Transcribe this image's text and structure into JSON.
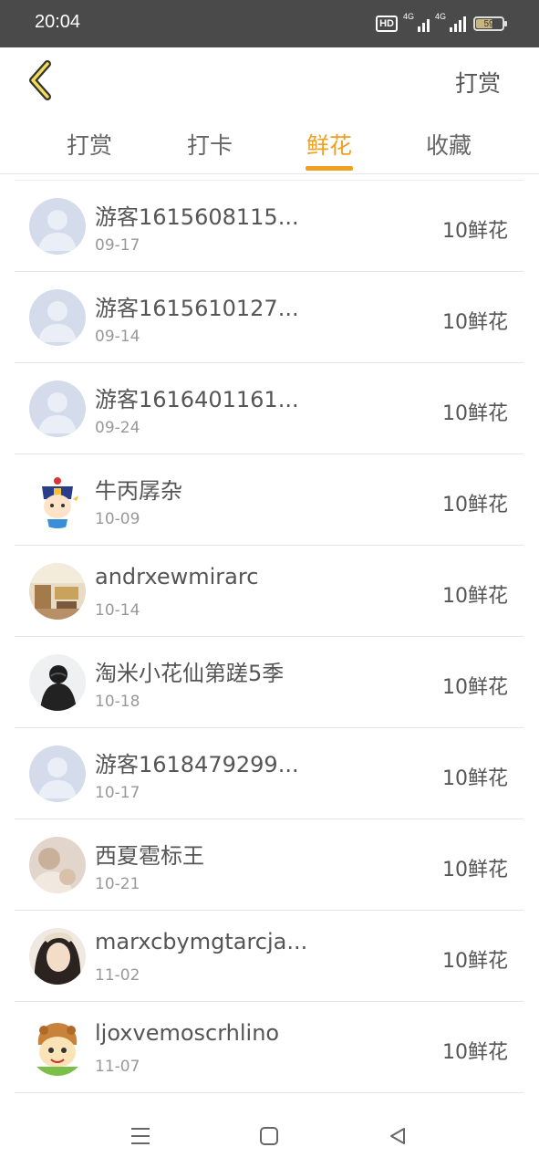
{
  "status_bar": {
    "time": "20:04",
    "hd_label": "HD",
    "network_1": "4G",
    "network_2": "4G",
    "battery": "59"
  },
  "header": {
    "action_label": "打赏",
    "back_icon": "chevron-left-icon",
    "accent_color": "#f0a020"
  },
  "tabs": [
    {
      "label": "打赏",
      "active": false
    },
    {
      "label": "打卡",
      "active": false
    },
    {
      "label": "鲜花",
      "active": true
    },
    {
      "label": "收藏",
      "active": false
    }
  ],
  "records": [
    {
      "name": "游客1615608115...",
      "date": "09-17",
      "amount": "10鲜花",
      "avatar": "default-avatar"
    },
    {
      "name": "游客1615610127...",
      "date": "09-14",
      "amount": "10鲜花",
      "avatar": "default-avatar"
    },
    {
      "name": "游客1616401161...",
      "date": "09-24",
      "amount": "10鲜花",
      "avatar": "default-avatar"
    },
    {
      "name": "牛丙孱杂",
      "date": "10-09",
      "amount": "10鲜花",
      "avatar": "cartoon-avatar"
    },
    {
      "name": "andrxewmirarc",
      "date": "10-14",
      "amount": "10鲜花",
      "avatar": "photo-avatar"
    },
    {
      "name": "淘米小花仙第蹉5季",
      "date": "10-18",
      "amount": "10鲜花",
      "avatar": "photo-avatar"
    },
    {
      "name": "游客1618479299...",
      "date": "10-17",
      "amount": "10鲜花",
      "avatar": "default-avatar"
    },
    {
      "name": "西夏雹标王",
      "date": "10-21",
      "amount": "10鲜花",
      "avatar": "photo-avatar"
    },
    {
      "name": "marxcbymgtarcja...",
      "date": "11-02",
      "amount": "10鲜花",
      "avatar": "photo-avatar"
    },
    {
      "name": "ljoxvemoscrhlino",
      "date": "11-07",
      "amount": "10鲜花",
      "avatar": "cartoon-avatar"
    }
  ],
  "nav_bar": {
    "icons": [
      "menu-icon",
      "home-square-icon",
      "back-triangle-icon"
    ]
  }
}
